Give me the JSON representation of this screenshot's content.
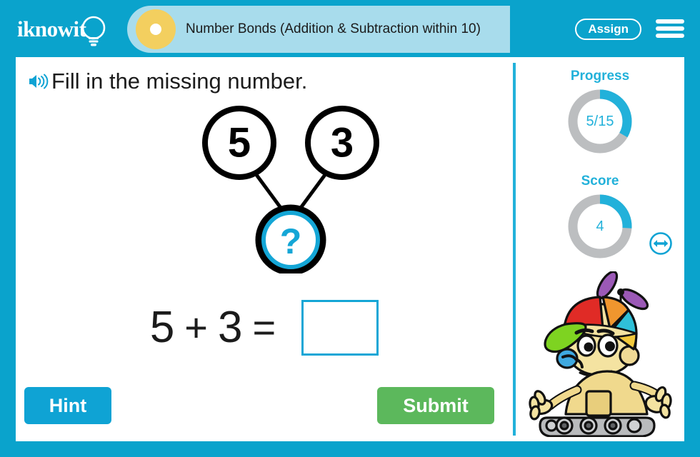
{
  "header": {
    "logo_text": "iknowit",
    "logo_icon": "lightbulb-icon",
    "title": "Number Bonds (Addition & Subtraction within 10)",
    "assign_label": "Assign",
    "menu_icon": "hamburger-menu-icon",
    "bar_color": "#0aa3cc",
    "pill_color": "#a8dcec",
    "dot_color": "#f3cf5f"
  },
  "main": {
    "audio_icon": "speaker-icon",
    "prompt": "Fill in the missing number.",
    "number_bond": {
      "part_a": "5",
      "part_b": "3",
      "whole": "?",
      "whole_ring_color": "#14a6d6"
    },
    "equation": {
      "left": "5",
      "operator": "+",
      "right": "3",
      "equals": "=",
      "answer_value": "",
      "answer_placeholder": ""
    },
    "hint_label": "Hint",
    "hint_color": "#0fa3d4",
    "submit_label": "Submit",
    "submit_color": "#5cb85c"
  },
  "sidebar": {
    "progress": {
      "label": "Progress",
      "value": "5/15",
      "current": 5,
      "total": 15,
      "percent": 33
    },
    "score": {
      "label": "Score",
      "value": "4",
      "percent": 26
    },
    "accent_color": "#22b1da",
    "track_color": "#bcbec0",
    "mascot_icon": "robot-mascot-with-propeller-cap",
    "resize_icon": "horizontal-resize-arrows-icon"
  }
}
